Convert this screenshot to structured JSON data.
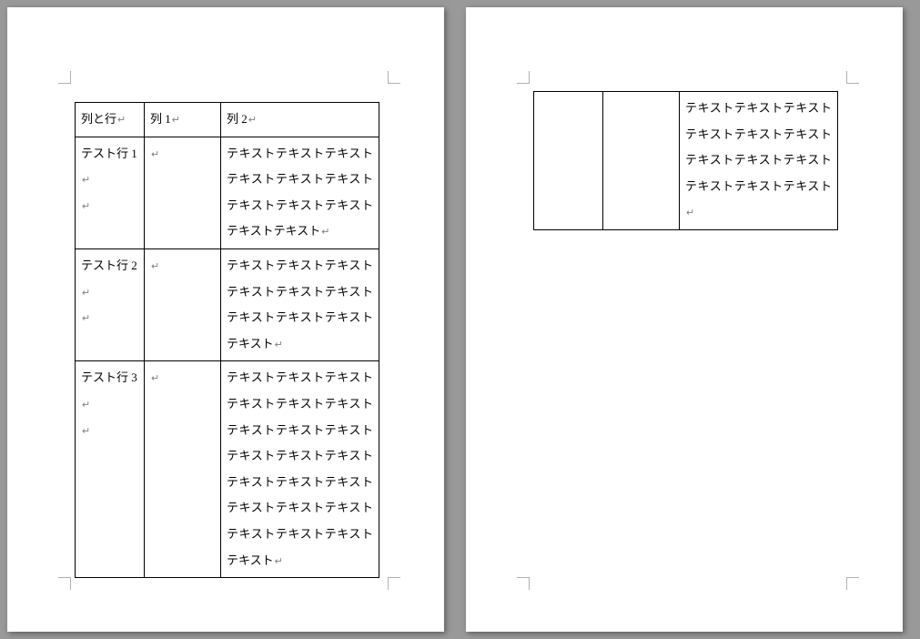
{
  "paragraph_mark": "↵",
  "page1": {
    "table": {
      "header": [
        "列と行",
        "列 1",
        "列 2"
      ],
      "rows": [
        {
          "label": "テスト行 1",
          "col1": "",
          "col2": "テキストテキストテキストテキストテキストテキストテキストテキストテキストテキストテキスト"
        },
        {
          "label": "テスト行 2",
          "col1": "",
          "col2": "テキストテキストテキストテキストテキストテキストテキストテキストテキストテキスト"
        },
        {
          "label": "テスト行 3",
          "col1": "",
          "col2": "テキストテキストテキストテキストテキストテキストテキストテキストテキストテキストテキストテキストテキストテキストテキストテキストテキストテキストテキストテキストテキストテキスト"
        }
      ]
    }
  },
  "page2": {
    "table": {
      "rows": [
        {
          "col0": "",
          "col1": "",
          "col2": "テキストテキストテキストテキストテキストテキストテキストテキストテキストテキストテキストテキスト"
        }
      ]
    }
  }
}
